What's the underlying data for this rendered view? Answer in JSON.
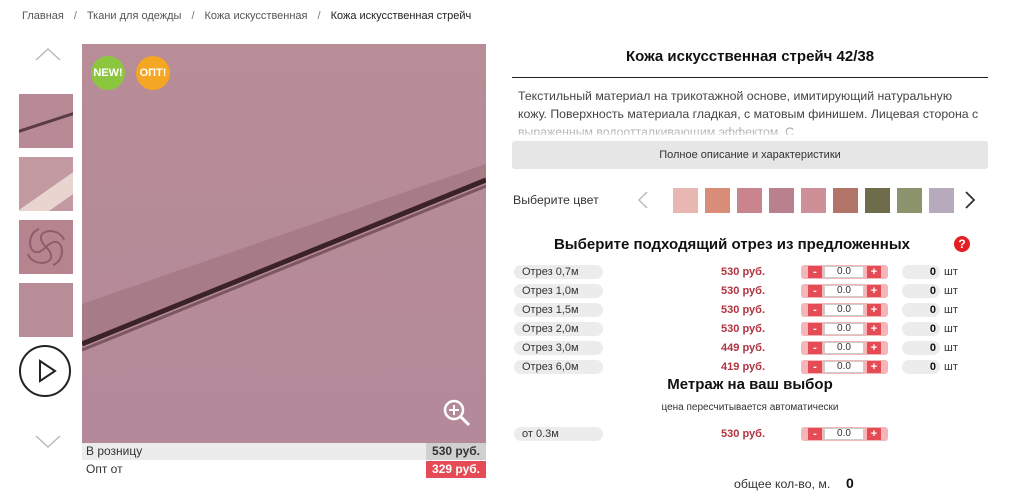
{
  "breadcrumb": [
    "Главная",
    "Ткани для одежды",
    "Кожа искусственная",
    "Кожа искусственная стрейч"
  ],
  "product": {
    "title": "Кожа искусственная стрейч 42/38",
    "description": "Текстильный материал на трикотажной основе, имитирующий натуральную кожу. Поверхность материала гладкая, с матовым финишем. Лицевая сторона с выраженным водоотталкивающим эффектом. С",
    "full_description_button": "Полное описание и характеристики",
    "badges": {
      "new": "NEW!",
      "opt": "ОПТ!"
    }
  },
  "prices": {
    "retail_label": "В розницу",
    "retail_value": "530 руб.",
    "opt_label": "Опт от",
    "opt_value": "329 руб."
  },
  "color_select": {
    "label": "Выберите цвет",
    "swatches": [
      "#e9b7b2",
      "#d98c78",
      "#c9848e",
      "#b9808e",
      "#cf8f98",
      "#b27468",
      "#6e6c4a",
      "#8b946c",
      "#b7aabd"
    ]
  },
  "cuts": {
    "heading": "Выберите подходящий отрез из предложенных",
    "help_icon": "?",
    "unit": "шт",
    "rows": [
      {
        "label": "Отрез 0,7м",
        "price": "530 руб.",
        "value": "0.0",
        "qty": "0"
      },
      {
        "label": "Отрез 1,0м",
        "price": "530 руб.",
        "value": "0.0",
        "qty": "0"
      },
      {
        "label": "Отрез 1,5м",
        "price": "530 руб.",
        "value": "0.0",
        "qty": "0"
      },
      {
        "label": "Отрез 2,0м",
        "price": "530 руб.",
        "value": "0.0",
        "qty": "0"
      },
      {
        "label": "Отрез 3,0м",
        "price": "449 руб.",
        "value": "0.0",
        "qty": "0"
      },
      {
        "label": "Отрез 6,0м",
        "price": "419 руб.",
        "value": "0.0",
        "qty": "0"
      }
    ]
  },
  "custom_length": {
    "heading": "Метраж на ваш выбор",
    "subtitle": "цена пересчитывается автоматически",
    "label": "от 0.3м",
    "price": "530 руб.",
    "value": "0.0"
  },
  "stepper": {
    "minus": "-",
    "plus": "+"
  },
  "total": {
    "label": "общее кол-во, м.",
    "value": "0"
  },
  "colors": {
    "accent": "#e54b55",
    "price": "#b03340",
    "fabric": "#b78c96",
    "new_badge": "#8cc63f",
    "opt_badge": "#f5a623"
  }
}
